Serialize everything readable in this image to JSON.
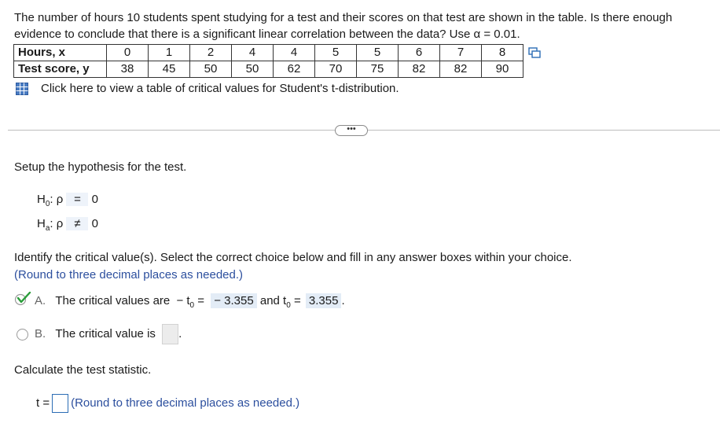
{
  "question": {
    "prompt": "The number of hours 10 students spent studying for a test and their scores on that test are shown in the table. Is there enough evidence to conclude that there is a significant linear correlation between the data? Use α = 0.01.",
    "table": {
      "row_x_label": "Hours, x",
      "row_y_label": "Test score, y",
      "x_values": [
        "0",
        "1",
        "2",
        "4",
        "4",
        "5",
        "5",
        "6",
        "7",
        "8"
      ],
      "y_values": [
        "38",
        "45",
        "50",
        "50",
        "62",
        "70",
        "75",
        "82",
        "82",
        "90"
      ]
    },
    "link_text": "Click here to view a table of critical values for Student's t-distribution."
  },
  "more_button": "•••",
  "hypothesis": {
    "intro": "Setup the hypothesis for the test.",
    "h0_label": "H",
    "h0_sub": "0",
    "h0_rest": ": ρ",
    "h0_relation": "=",
    "h0_value": "0",
    "ha_label": "H",
    "ha_sub": "a",
    "ha_rest": ": ρ",
    "ha_relation": "≠",
    "ha_value": "0"
  },
  "critical": {
    "instruction": "Identify the critical value(s). Select the correct choice below and fill in any answer boxes within your choice.",
    "round_note": "(Round to three decimal places as needed.)",
    "choice_a_letter": "A.",
    "choice_a_text": "The critical values are",
    "choice_a_neg_t": "− t",
    "choice_a_sub": "0",
    "choice_a_eq": "=",
    "choice_a_value1": "− 3.355",
    "choice_a_and": "and t",
    "choice_a_sub2": "0",
    "choice_a_eq2": "=",
    "choice_a_value2": "3.355",
    "choice_a_selected": true,
    "choice_b_letter": "B.",
    "choice_b_text": "The critical value is"
  },
  "statistic": {
    "instruction": "Calculate the test statistic.",
    "t_label": "t =",
    "round_note": "(Round to three decimal places as needed.)"
  },
  "colors": {
    "link_blue": "#2c4f9e",
    "answer_bg": "#e3ecf6",
    "check_green": "#2a9d3a"
  }
}
